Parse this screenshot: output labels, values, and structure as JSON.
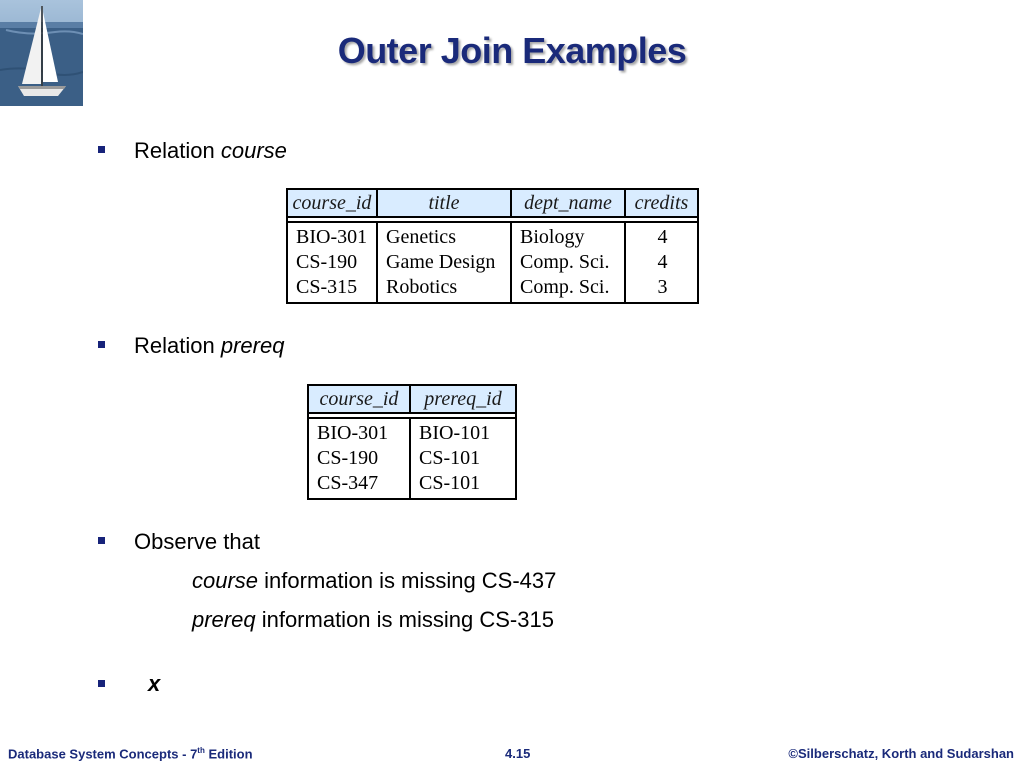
{
  "slide": {
    "title": "Outer Join Examples"
  },
  "bullets": {
    "course": {
      "prefix": "Relation ",
      "name": "course"
    },
    "prereq": {
      "prefix": "Relation ",
      "name": "prereq"
    },
    "observe": {
      "text": "Observe that"
    },
    "note1": {
      "name": "course",
      "rest": " information is missing CS-437"
    },
    "note2": {
      "name": "prereq",
      "rest": " information is missing CS-315"
    },
    "x": {
      "text": "x"
    }
  },
  "course_table": {
    "headers": [
      "course_id",
      "title",
      "dept_name",
      "credits"
    ],
    "rows": [
      [
        "BIO-301",
        "Genetics",
        "Biology",
        "4"
      ],
      [
        "CS-190",
        "Game Design",
        "Comp. Sci.",
        "4"
      ],
      [
        "CS-315",
        "Robotics",
        "Comp. Sci.",
        "3"
      ]
    ]
  },
  "prereq_table": {
    "headers": [
      "course_id",
      "prereq_id"
    ],
    "rows": [
      [
        "BIO-301",
        "BIO-101"
      ],
      [
        "CS-190",
        "CS-101"
      ],
      [
        "CS-347",
        "CS-101"
      ]
    ]
  },
  "footer": {
    "left_main": "Database System Concepts - 7",
    "left_sup": "th",
    "left_tail": " Edition",
    "page": "4.15",
    "right": "©Silberschatz, Korth and Sudarshan"
  },
  "colors": {
    "title": "#1a2a7a",
    "bullet": "#17237a",
    "header_fill": "#d9ecff"
  }
}
